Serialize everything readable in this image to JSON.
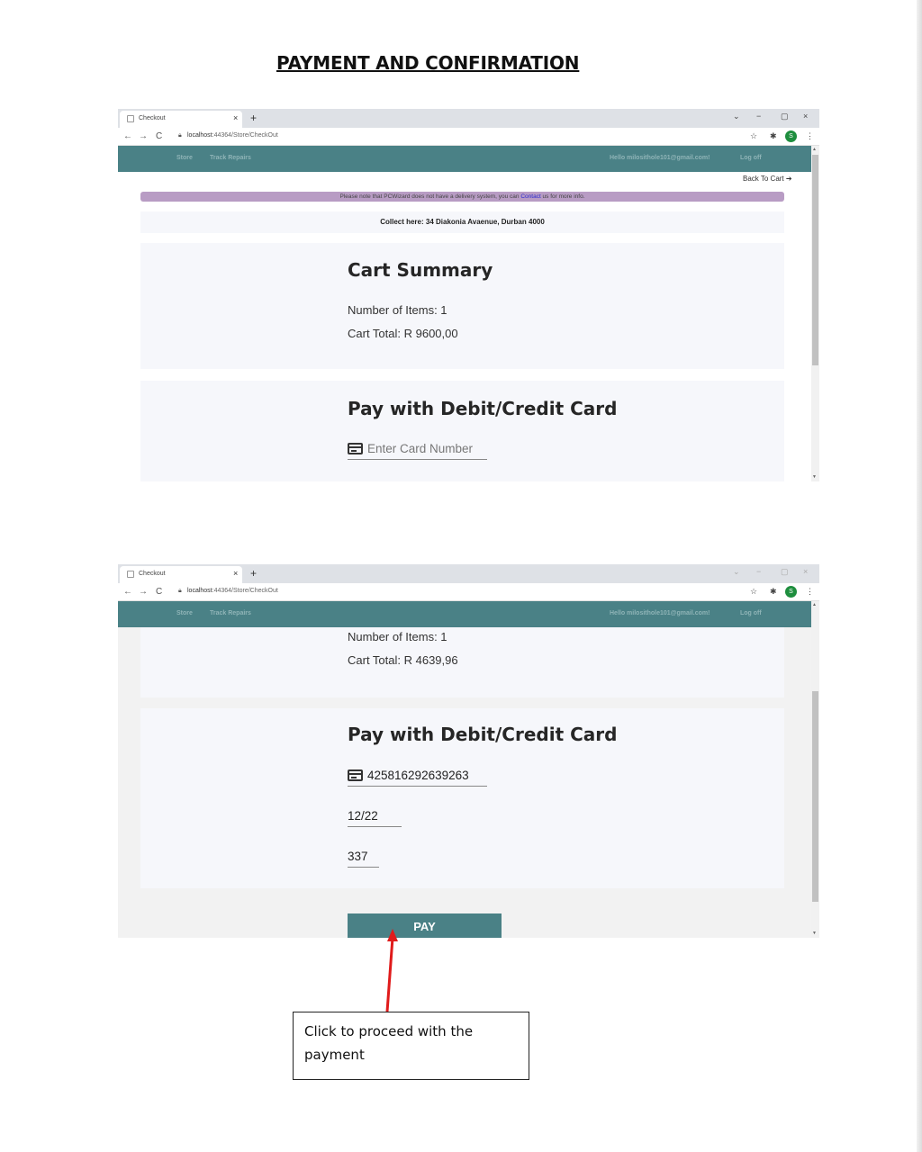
{
  "document": {
    "title": "PAYMENT AND CONFIRMATION",
    "callout_text": "Click to proceed with the payment"
  },
  "browser": {
    "tab_title": "Checkout",
    "tab_close": "×",
    "new_tab": "+",
    "url_host": "localhost",
    "url_rest": ":44364/Store/CheckOut",
    "profile_initial": "S",
    "window_controls": [
      "⌄",
      "−",
      "▢",
      "×"
    ]
  },
  "nav": {
    "store": "Store",
    "track_repairs": "Track Repairs",
    "greeting": "Hello milosithole101@gmail.com!",
    "log_off": "Log off"
  },
  "screen1": {
    "back_to_cart": "Back To Cart ➔",
    "notice_before": "Please note that PCWizard does not have a delivery system, you can ",
    "notice_link": "Contact",
    "notice_after": " us for more info.",
    "collect": "Collect here: 34 Diakonia Avaenue, Durban 4000",
    "summary_heading": "Cart Summary",
    "items": "Number of Items: 1",
    "total": "Cart Total: R 9600,00",
    "pay_heading": "Pay with Debit/Credit Card",
    "card_placeholder": "Enter Card Number"
  },
  "screen2": {
    "items": "Number of Items: 1",
    "total": "Cart Total: R 4639,96",
    "pay_heading": "Pay with Debit/Credit Card",
    "card_number": "425816292639263",
    "expiry": "12/22",
    "cvv": "337",
    "pay_button": "PAY"
  },
  "colors": {
    "nav_bg": "#4a8186",
    "notice_bg": "#b89cc4",
    "arrow": "#e01b1b"
  }
}
